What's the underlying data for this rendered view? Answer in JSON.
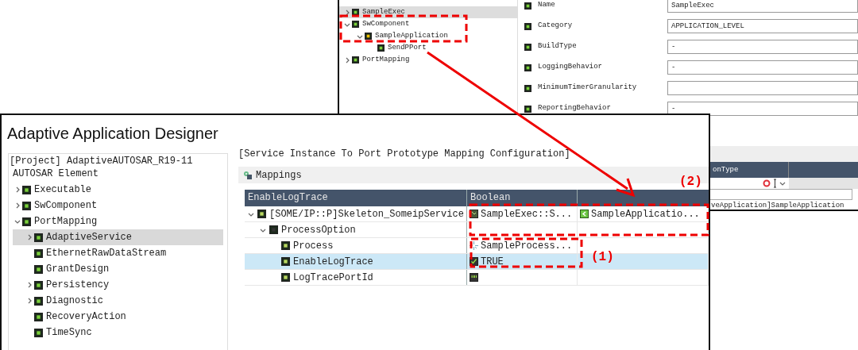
{
  "back_window": {
    "tree": [
      {
        "label": "SampleExec",
        "expanded": false,
        "selected": true
      },
      {
        "label": "SwComponent",
        "expanded": true,
        "selected": false,
        "children": [
          {
            "label": "SampleApplication",
            "expanded": true,
            "selected": false,
            "children": [
              {
                "label": "SendPPort",
                "selected": false
              }
            ]
          }
        ]
      },
      {
        "label": "PortMapping",
        "expanded": false,
        "selected": false
      }
    ],
    "properties": [
      {
        "label": "Name",
        "value": "SampleExec"
      },
      {
        "label": "Category",
        "value": "APPLICATION_LEVEL"
      },
      {
        "label": "BuildType",
        "value": "-"
      },
      {
        "label": "LoggingBehavior",
        "value": "-"
      },
      {
        "label": "MinimumTimerGranularity"
      },
      {
        "label": "ReportingBehavior",
        "value": "-"
      }
    ],
    "table": {
      "columns": [
        "onType"
      ],
      "row_text": "veApplication]SampleApplication"
    }
  },
  "front_window": {
    "title": "Adaptive Application Designer",
    "project_panel": {
      "title": "[Project] AdaptiveAUTOSAR_R19-11",
      "heading": "AUTOSAR Element",
      "tree": [
        {
          "label": "Executable",
          "expanded": false,
          "selected": false
        },
        {
          "label": "SwComponent",
          "expanded": false,
          "selected": false
        },
        {
          "label": "PortMapping",
          "expanded": true,
          "selected": false,
          "children": [
            {
              "label": "AdaptiveService",
              "expanded": false,
              "selected": true
            },
            {
              "label": "EthernetRawDataStream",
              "selected": false
            },
            {
              "label": "GrantDesign",
              "selected": false
            },
            {
              "label": "Persistency",
              "expanded": false,
              "selected": false
            },
            {
              "label": "Diagnostic",
              "expanded": false,
              "selected": false
            },
            {
              "label": "RecoveryAction",
              "selected": false
            },
            {
              "label": "TimeSync",
              "selected": false
            }
          ]
        }
      ]
    },
    "config_panel": {
      "title": "[Service Instance To Port Prototype Mapping Configuration]",
      "section": "Mappings",
      "table": {
        "columns": [
          "EnableLogTrace",
          "Boolean"
        ],
        "rows": [
          {
            "expanded": true,
            "selected": false,
            "cells": [
              {
                "text": "[SOME/IP::P]Skeleton_SomeipService"
              },
              {
                "kind": "reference",
                "text": "SampleExec::S..."
              },
              {
                "kind": "port",
                "text": "SampleApplicatio..."
              }
            ],
            "children": [
              {
                "expanded": true,
                "selected": false,
                "cells": [
                  {
                    "text": "ProcessOption"
                  }
                ],
                "children": [
                  {
                    "selected": false,
                    "cells": [
                      {
                        "text": "Process"
                      },
                      {
                        "kind": "process",
                        "text": "SampleProcess..."
                      }
                    ]
                  },
                  {
                    "selected": true,
                    "cells": [
                      {
                        "text": "EnableLogTrace"
                      },
                      {
                        "kind": "boolean",
                        "text": "TRUE"
                      }
                    ]
                  },
                  {
                    "selected": false,
                    "cells": [
                      {
                        "text": "LogTracePortId"
                      },
                      {
                        "kind": "string"
                      }
                    ]
                  }
                ]
              }
            ]
          }
        ]
      }
    }
  },
  "annotations": [
    {
      "label": "(2)"
    },
    {
      "label": "(1)"
    }
  ]
}
